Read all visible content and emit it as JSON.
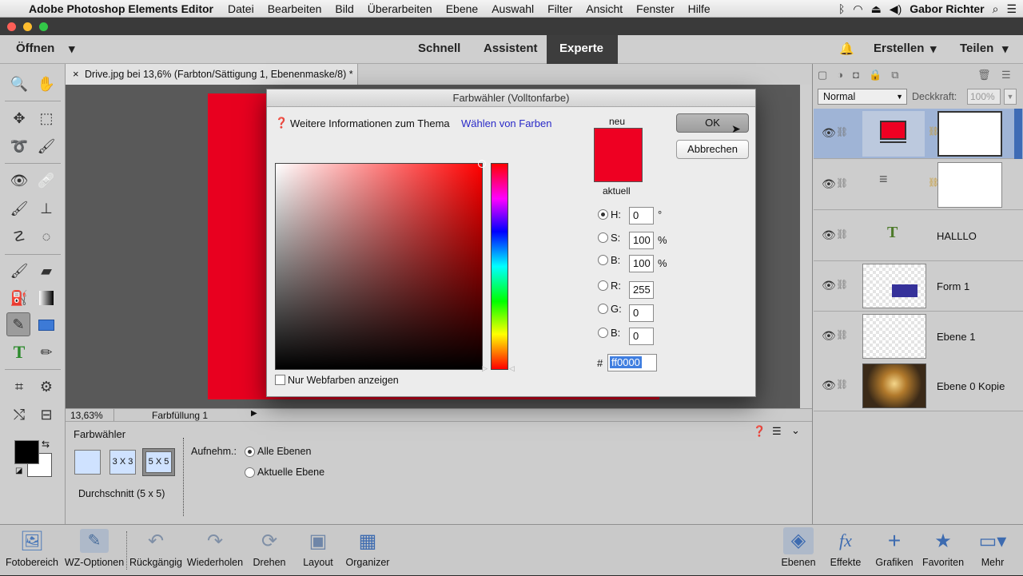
{
  "menubar": {
    "app": "Adobe Photoshop Elements Editor",
    "items": [
      "Datei",
      "Bearbeiten",
      "Bild",
      "Überarbeiten",
      "Ebene",
      "Auswahl",
      "Filter",
      "Ansicht",
      "Fenster",
      "Hilfe"
    ],
    "user": "Gabor Richter"
  },
  "header": {
    "open_label": "Öffnen",
    "tabs": [
      "Schnell",
      "Assistent",
      "Experte"
    ],
    "create_label": "Erstellen",
    "share_label": "Teilen"
  },
  "document": {
    "tab_title": "Drive.jpg bei 13,6% (Farbton/Sättigung 1, Ebenenmaske/8) *",
    "zoom": "13,63%",
    "status": "Farbfüllung 1",
    "canvas_color": "#e8001f"
  },
  "dialog": {
    "title": "Farbwähler (Volltonfarbe)",
    "info_text": "Weitere Informationen zum Thema",
    "info_link": "Wählen von Farben",
    "ok_label": "OK",
    "cancel_label": "Abbrechen",
    "new_label": "neu",
    "current_label": "aktuell",
    "new_color": "#ee0022",
    "web_only_label": "Nur Webfarben anzeigen",
    "fields": {
      "h_label": "H:",
      "h": "0",
      "h_unit": "°",
      "s_label": "S:",
      "s": "100",
      "s_unit": "%",
      "b_label": "B:",
      "b": "100",
      "b_unit": "%",
      "r_label": "R:",
      "r": "255",
      "g_label": "G:",
      "g": "0",
      "bl_label": "B:",
      "bl": "0",
      "hex_label": "#",
      "hex": "ff0000"
    }
  },
  "options": {
    "title": "Farbwähler",
    "size_3": "3 X 3",
    "size_5": "5 X 5",
    "average_label": "Durchschnitt (5 x 5)",
    "sample_label": "Aufnehm.:",
    "all_layers": "Alle Ebenen",
    "current_layer": "Aktuelle Ebene"
  },
  "layers_panel": {
    "blend_mode": "Normal",
    "opacity_label": "Deckkraft:",
    "opacity_value": "100%",
    "layers": [
      "",
      "",
      "HALLLO",
      "Form 1",
      "Ebene 1",
      "Ebene 0 Kopie"
    ]
  },
  "bottombar": {
    "left": [
      "Fotobereich",
      "WZ-Optionen",
      "Rückgängig",
      "Wiederholen",
      "Drehen",
      "Layout",
      "Organizer"
    ],
    "right": [
      "Ebenen",
      "Effekte",
      "Grafiken",
      "Favoriten",
      "Mehr"
    ]
  }
}
